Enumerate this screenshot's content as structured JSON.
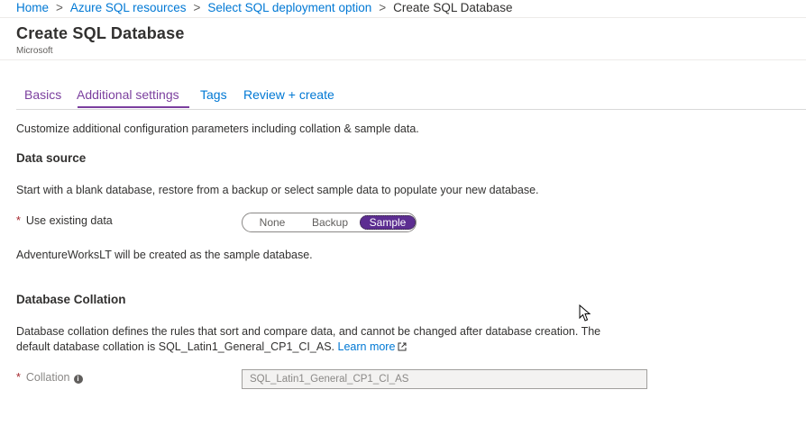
{
  "breadcrumb": {
    "items": [
      "Home",
      "Azure SQL resources",
      "Select SQL deployment option"
    ],
    "current": "Create SQL Database",
    "separator": ">"
  },
  "header": {
    "title": "Create SQL Database",
    "subtitle": "Microsoft"
  },
  "tabs": [
    {
      "label": "Basics",
      "active": false
    },
    {
      "label": "Additional settings",
      "active": true
    },
    {
      "label": "Tags",
      "active": false
    },
    {
      "label": "Review + create",
      "active": false
    }
  ],
  "intro": "Customize additional configuration parameters including collation & sample data.",
  "data_source": {
    "title": "Data source",
    "description": "Start with a blank database, restore from a backup or select sample data to populate your new database.",
    "required_marker": "*",
    "label": "Use existing data",
    "options": [
      "None",
      "Backup",
      "Sample"
    ],
    "selected": "Sample",
    "note": "AdventureWorksLT will be created as the sample database."
  },
  "collation": {
    "title": "Database Collation",
    "description_line1": "Database collation defines the rules that sort and compare data, and cannot be changed after database creation. The",
    "description_line2": "default database collation is SQL_Latin1_General_CP1_CI_AS.",
    "learn_more": "Learn more",
    "required_marker": "*",
    "label": "Collation",
    "value": "SQL_Latin1_General_CP1_CI_AS"
  },
  "colors": {
    "link": "#0078d4",
    "active_tab": "#7b3f9e",
    "toggle_selected": "#5c2d91",
    "required": "#a4262c"
  }
}
